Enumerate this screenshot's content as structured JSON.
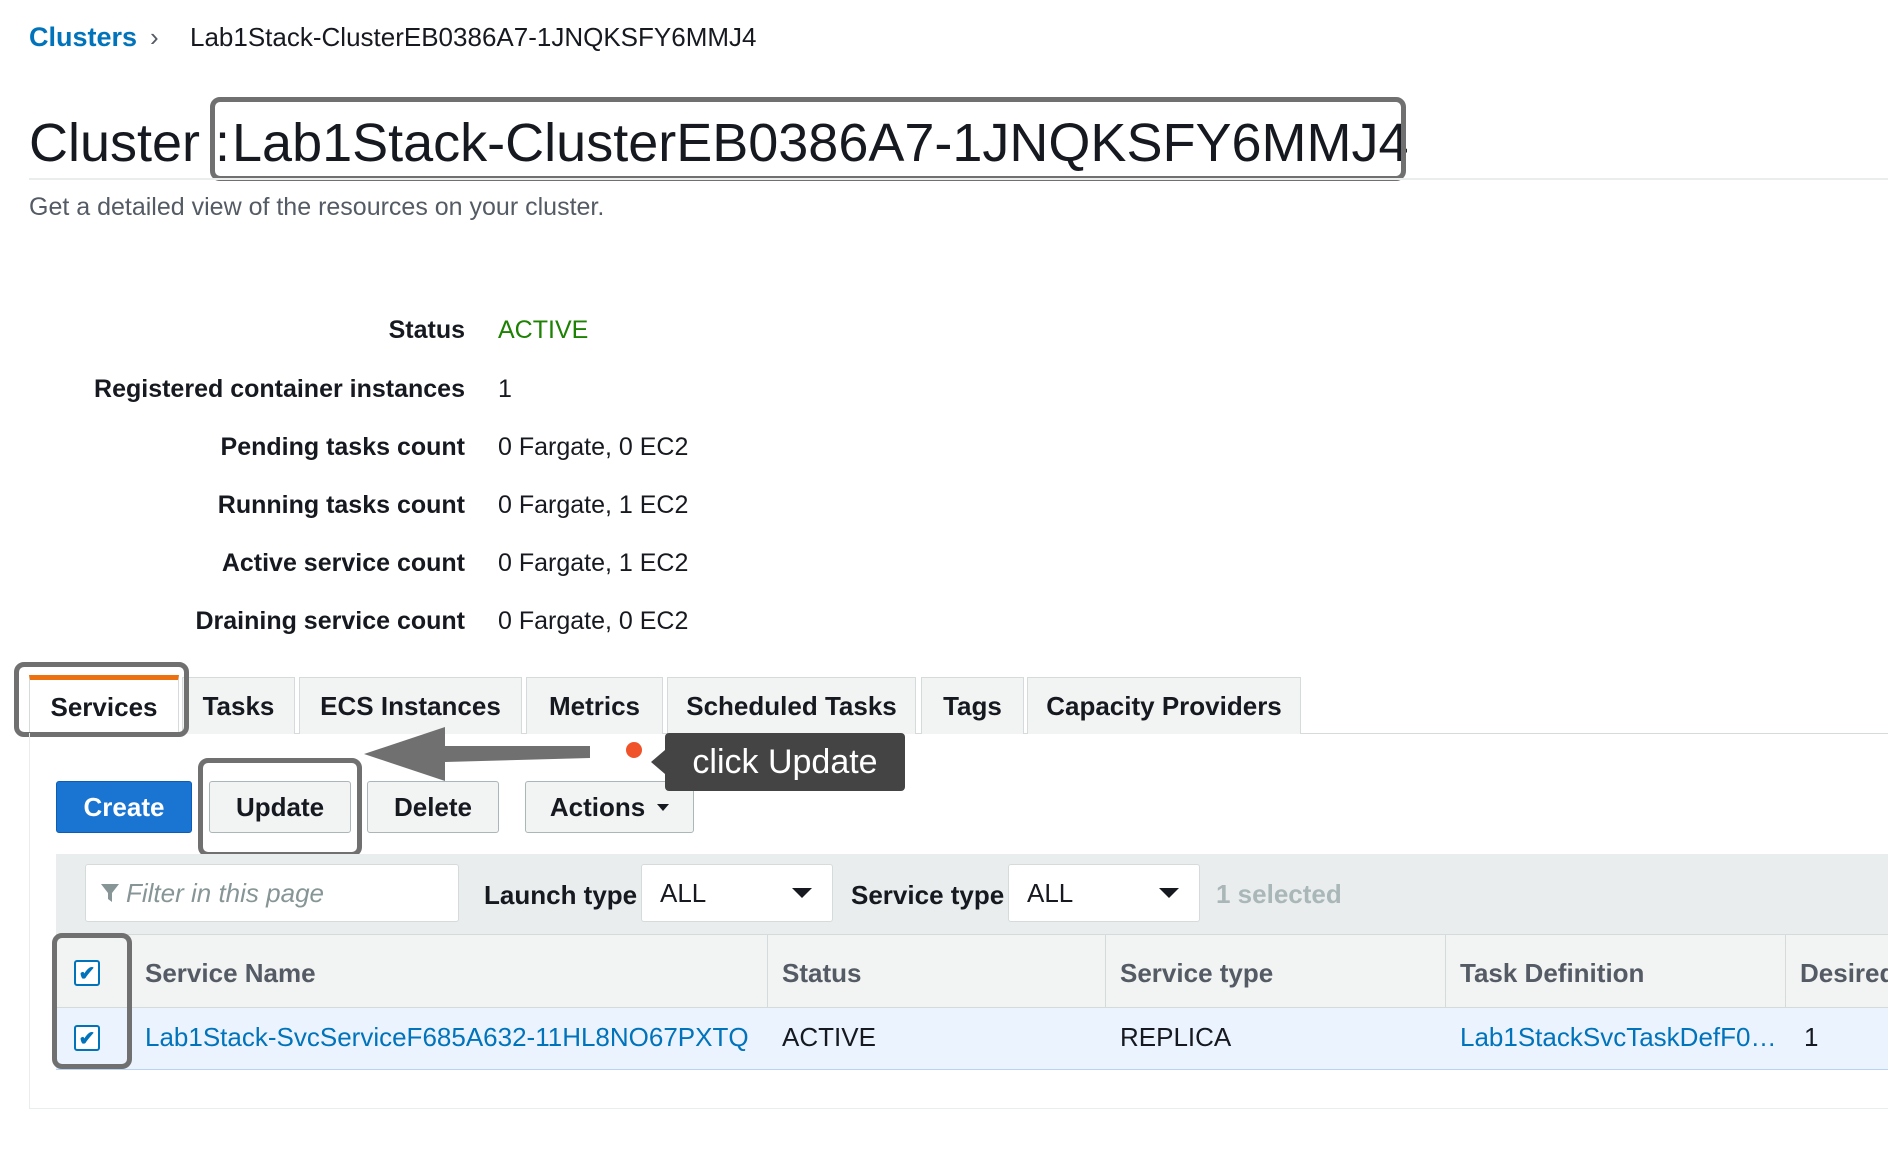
{
  "breadcrumb": {
    "root": "Clusters",
    "separator": "›",
    "current": "Lab1Stack-ClusterEB0386A7-1JNQKSFY6MMJ4"
  },
  "header": {
    "prefix": "Cluster :",
    "name": "Lab1Stack-ClusterEB0386A7-1JNQKSFY6MMJ4",
    "subtitle": "Get a detailed view of the resources on your cluster."
  },
  "details": [
    {
      "label": "Status",
      "value": "ACTIVE"
    },
    {
      "label": "Registered container instances",
      "value": "1"
    },
    {
      "label": "Pending tasks count",
      "value": "0 Fargate, 0 EC2"
    },
    {
      "label": "Running tasks count",
      "value": "0 Fargate, 1 EC2"
    },
    {
      "label": "Active service count",
      "value": "0 Fargate, 1 EC2"
    },
    {
      "label": "Draining service count",
      "value": "0 Fargate, 0 EC2"
    }
  ],
  "tabs": [
    "Services",
    "Tasks",
    "ECS Instances",
    "Metrics",
    "Scheduled Tasks",
    "Tags",
    "Capacity Providers"
  ],
  "active_tab": "Services",
  "toolbar": {
    "create": "Create",
    "update": "Update",
    "delete": "Delete",
    "actions": "Actions"
  },
  "tooltip": "click Update",
  "filters": {
    "placeholder": "Filter in this page",
    "launch_type_label": "Launch type",
    "launch_type_value": "ALL",
    "service_type_label": "Service type",
    "service_type_value": "ALL",
    "selected_text": "1 selected"
  },
  "table": {
    "columns": [
      "Service Name",
      "Status",
      "Service type",
      "Task Definition",
      "Desired"
    ],
    "rows": [
      {
        "service_name": "Lab1Stack-SvcServiceF685A632-11HL8NO67PXTQ",
        "status": "ACTIVE",
        "service_type": "REPLICA",
        "task_definition": "Lab1StackSvcTaskDefF0…",
        "desired": "1"
      }
    ]
  },
  "colors": {
    "link": "#0073bb",
    "active_status": "#1d8102",
    "primary_button": "#1a74d1",
    "tab_accent": "#ec7211",
    "annotation_box": "#707070",
    "tooltip_bg": "#444444",
    "hotspot_dot": "#f0532a"
  },
  "icons": {
    "breadcrumb_separator": "chevron-right-icon",
    "filter": "filter-funnel-icon",
    "dropdown": "caret-down-icon",
    "checkbox": "checkmark-icon"
  }
}
